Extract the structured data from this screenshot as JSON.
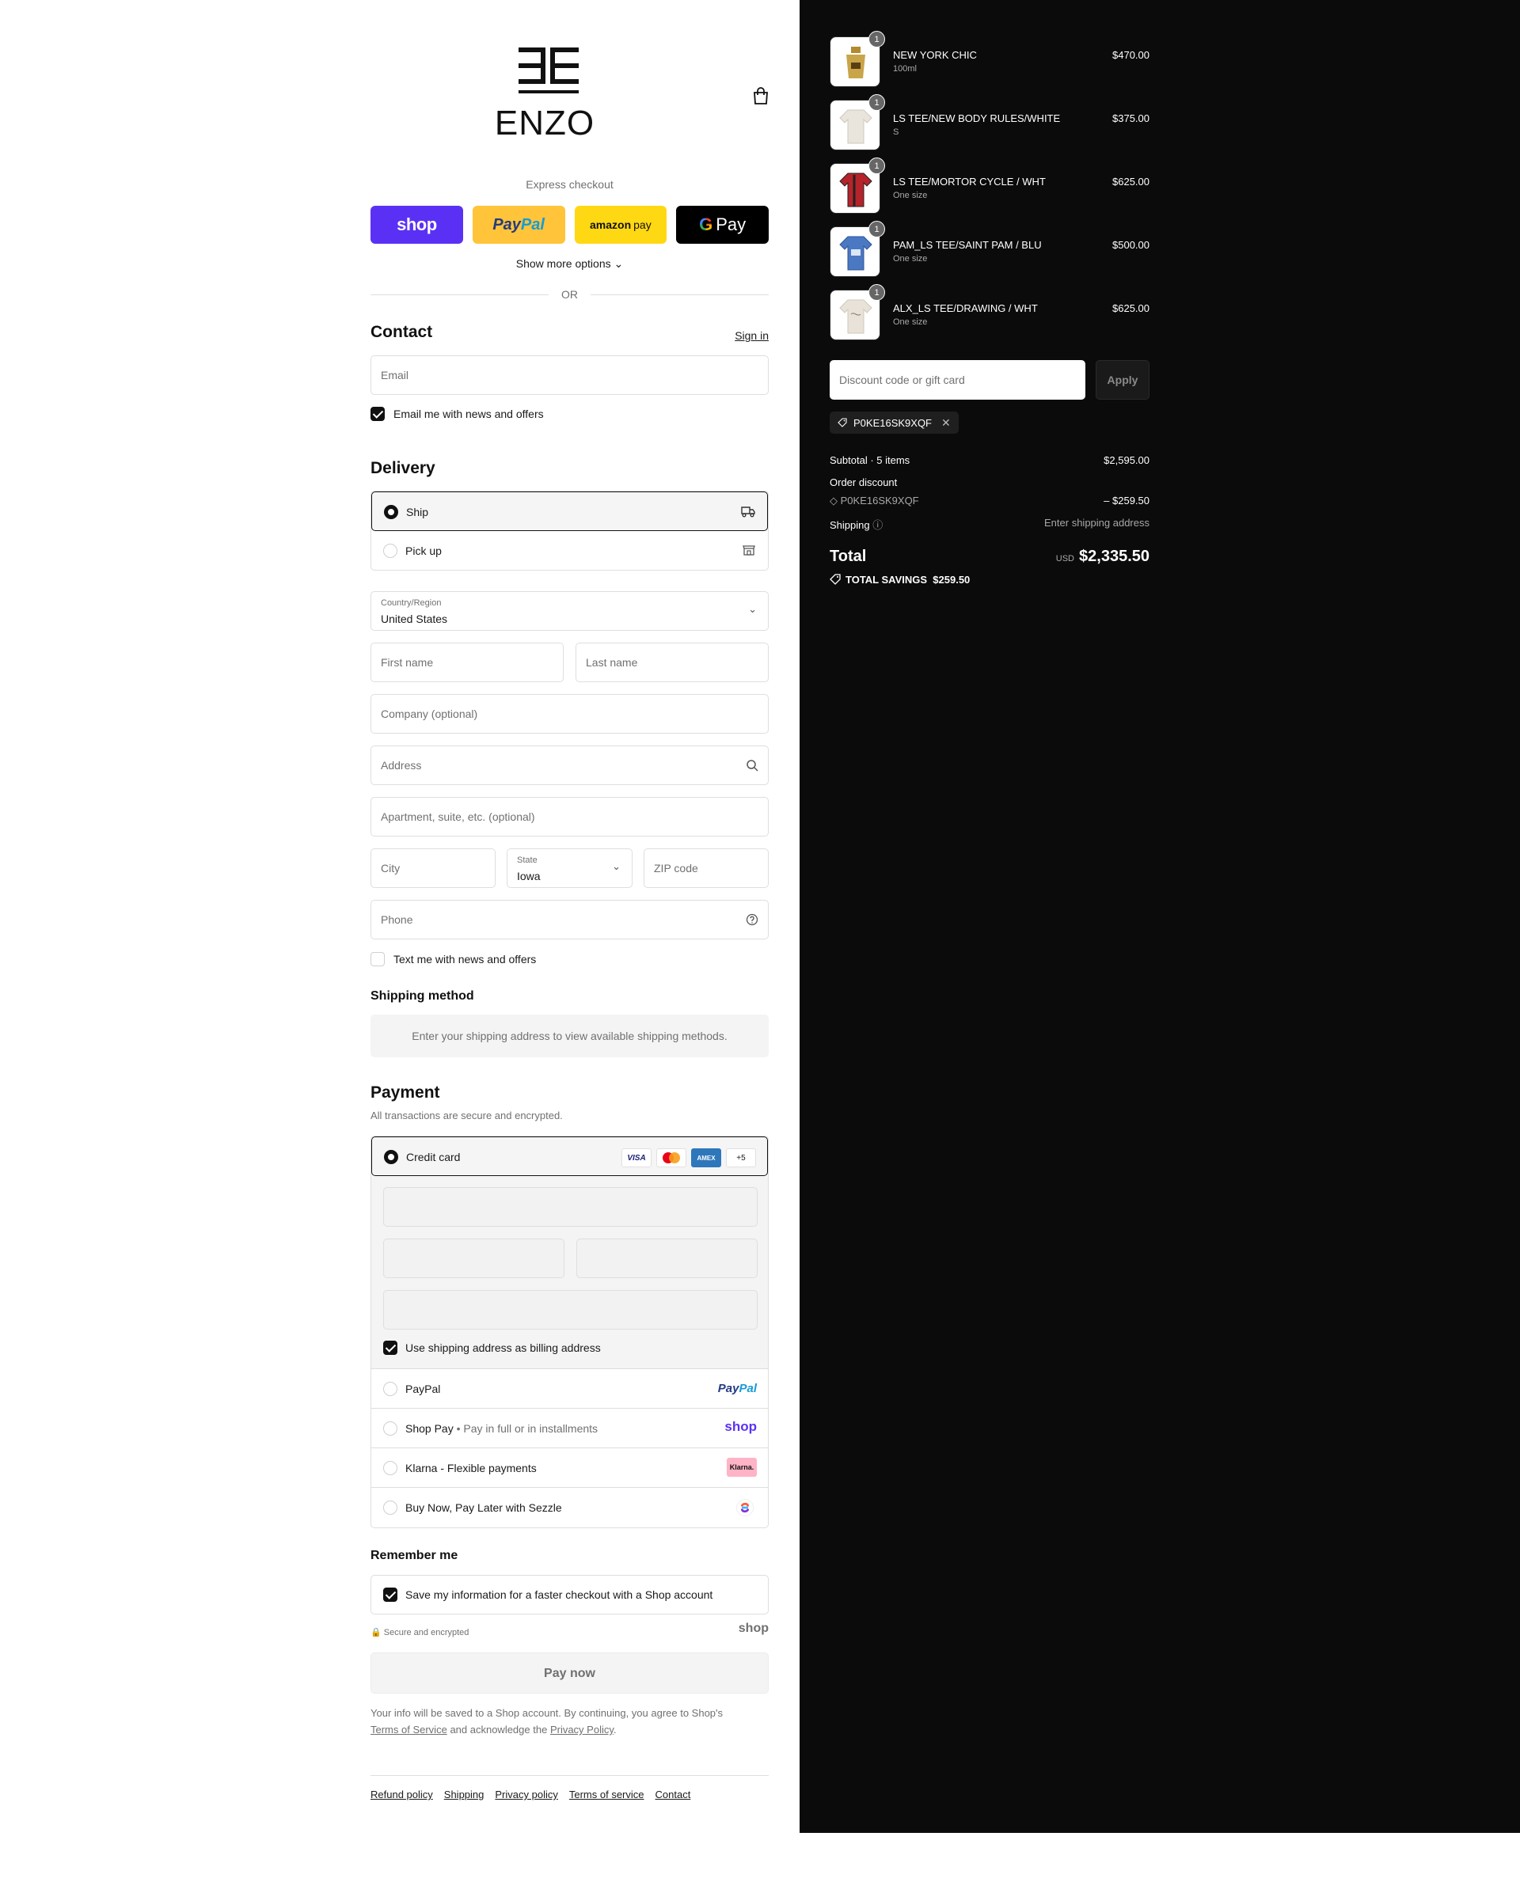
{
  "brand": {
    "name": "ENZO"
  },
  "express": {
    "label": "Express checkout",
    "shop_label": "shop",
    "paypal_label_1": "Pay",
    "paypal_label_2": "Pal",
    "amazon_label_1": "amazon",
    "amazon_label_2": "pay",
    "gpay_label_1": "G",
    "gpay_label_2": "Pay",
    "more_options": "Show more options",
    "or": "OR"
  },
  "contact": {
    "title": "Contact",
    "sign_in": "Sign in",
    "email_placeholder": "Email",
    "news_label": "Email me with news and offers",
    "news_checked": true
  },
  "delivery": {
    "title": "Delivery",
    "options": [
      {
        "label": "Ship",
        "selected": true,
        "icon": "truck-icon"
      },
      {
        "label": "Pick up",
        "selected": false,
        "icon": "store-icon"
      }
    ],
    "country_label": "Country/Region",
    "country_value": "United States",
    "first_name": "First name",
    "last_name": "Last name",
    "company": "Company (optional)",
    "address": "Address",
    "apartment": "Apartment, suite, etc. (optional)",
    "city": "City",
    "state_label": "State",
    "state_value": "Iowa",
    "zip": "ZIP code",
    "phone": "Phone",
    "text_offers": "Text me with news and offers"
  },
  "shipping_method": {
    "title": "Shipping method",
    "message": "Enter your shipping address to view available shipping methods."
  },
  "payment": {
    "title": "Payment",
    "subtitle": "All transactions are secure and encrypted.",
    "credit_card": "Credit card",
    "brands": [
      "VISA",
      "AMEX",
      "+5"
    ],
    "billing_same": "Use shipping address as billing address",
    "paypal": "PayPal",
    "paypal_logo_1": "Pay",
    "paypal_logo_2": "Pal",
    "shop_pay": "Shop Pay",
    "shop_pay_sub": "Pay in full or in installments",
    "shop_logo": "shop",
    "klarna": "Klarna - Flexible payments",
    "klarna_logo": "Klarna.",
    "sezzle": "Buy Now, Pay Later with Sezzle"
  },
  "remember": {
    "title": "Remember me",
    "save_label": "Save my information for a faster checkout with a Shop account",
    "secure": "Secure and encrypted",
    "shop": "shop"
  },
  "pay_now": "Pay now",
  "legal": {
    "text_1": "Your info will be saved to a Shop account. By continuing, you agree to Shop's",
    "terms": "Terms of Service",
    "text_2": "and acknowledge the",
    "privacy": "Privacy Policy",
    "text_3": "."
  },
  "footer": [
    "Refund policy",
    "Shipping",
    "Privacy policy",
    "Terms of service",
    "Contact"
  ],
  "cart": {
    "items": [
      {
        "name": "NEW YORK CHIC",
        "variant": "100ml",
        "price": "$470.00",
        "qty": "1",
        "color": "#c9a54a"
      },
      {
        "name": "LS TEE/NEW BODY RULES/WHITE",
        "variant": "S",
        "price": "$375.00",
        "qty": "1",
        "color": "#e9e4dc"
      },
      {
        "name": "LS TEE/MORTOR CYCLE / WHT",
        "variant": "One size",
        "price": "$625.00",
        "qty": "1",
        "color": "#b6232a"
      },
      {
        "name": "PAM_LS TEE/SAINT PAM / BLU",
        "variant": "One size",
        "price": "$500.00",
        "qty": "1",
        "color": "#4a78c2"
      },
      {
        "name": "ALX_LS TEE/DRAWING / WHT",
        "variant": "One size",
        "price": "$625.00",
        "qty": "1",
        "color": "#e8e2d8"
      }
    ],
    "discount_placeholder": "Discount code or gift card",
    "apply": "Apply",
    "code": "P0KE16SK9XQF",
    "subtotal_label": "Subtotal · 5 items",
    "subtotal": "$2,595.00",
    "order_discount": "Order discount",
    "discount_amount": "– $259.50",
    "shipping_label": "Shipping",
    "shipping_value": "Enter shipping address",
    "total_label": "Total",
    "currency": "USD",
    "total": "$2,335.50",
    "savings_label": "TOTAL SAVINGS",
    "savings": "$259.50"
  }
}
